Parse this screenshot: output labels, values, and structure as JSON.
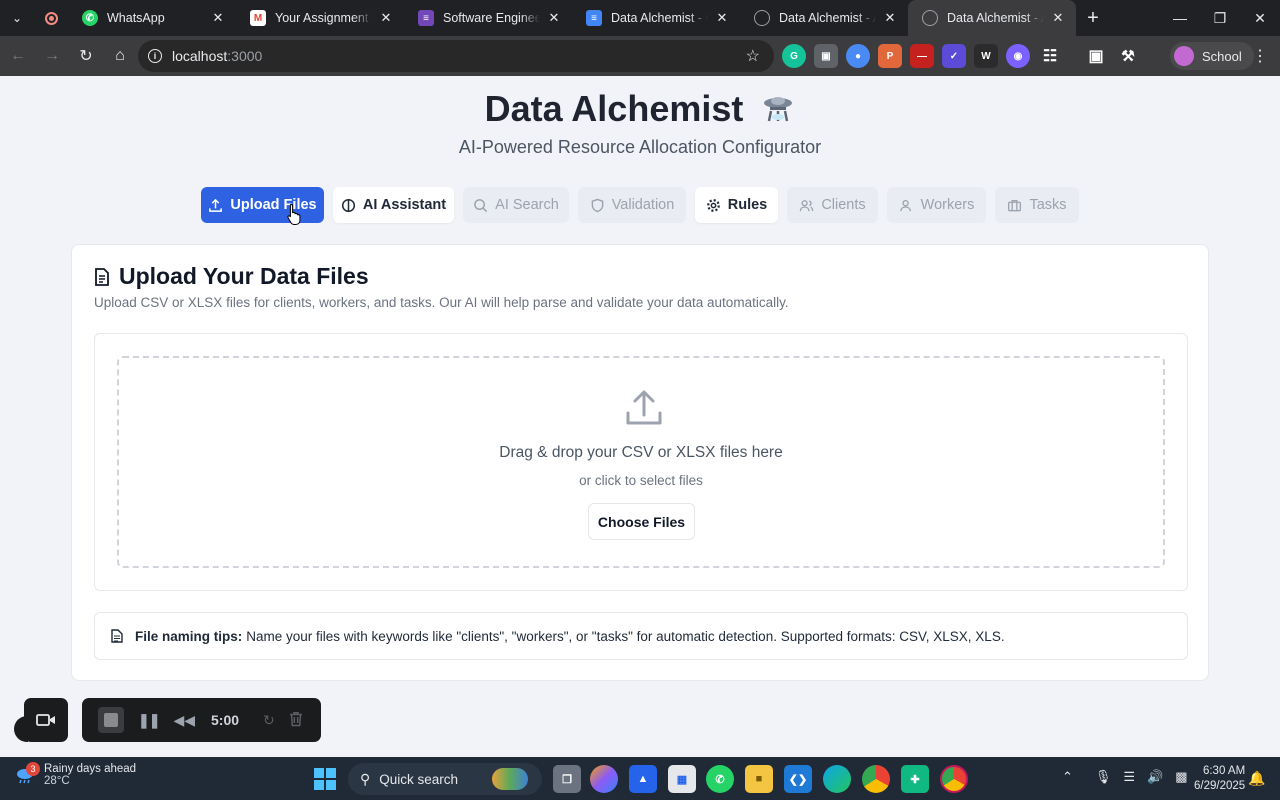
{
  "browser": {
    "tabs": [
      {
        "title": "WhatsApp",
        "favicon": "whatsapp-icon",
        "color": "#25d366"
      },
      {
        "title": "Your Assignment for th",
        "favicon": "gmail-icon",
        "color": "#ea4335"
      },
      {
        "title": "Software Engineering",
        "favicon": "forms-icon",
        "color": "#7248b9"
      },
      {
        "title": "Data Alchemist - Goo",
        "favicon": "docs-icon",
        "color": "#4285f4"
      },
      {
        "title": "Data Alchemist - AI Re",
        "favicon": "globe-icon",
        "color": "#9aa0a6"
      },
      {
        "title": "Data Alchemist - AI Re",
        "favicon": "globe-icon",
        "color": "#9aa0a6"
      }
    ],
    "url_host": "localhost",
    "url_port": ":3000",
    "profile_label": "School"
  },
  "app": {
    "title": "Data Alchemist",
    "subtitle": "AI-Powered Resource Allocation Configurator",
    "accent_color": "#2f62e3",
    "nav": [
      {
        "label": "Upload Files",
        "icon": "upload-icon",
        "state": "active"
      },
      {
        "label": "AI Assistant",
        "icon": "bulb-icon",
        "state": "enabled"
      },
      {
        "label": "AI Search",
        "icon": "search-icon",
        "state": "disabled"
      },
      {
        "label": "Validation",
        "icon": "shield-icon",
        "state": "disabled"
      },
      {
        "label": "Rules",
        "icon": "gear-icon",
        "state": "enabled"
      },
      {
        "label": "Clients",
        "icon": "users-icon",
        "state": "disabled"
      },
      {
        "label": "Workers",
        "icon": "user-icon",
        "state": "disabled"
      },
      {
        "label": "Tasks",
        "icon": "briefcase-icon",
        "state": "disabled"
      }
    ]
  },
  "upload": {
    "heading": "Upload Your Data Files",
    "description": "Upload CSV or XLSX files for clients, workers, and tasks. Our AI will help parse and validate your data automatically.",
    "drop_main": "Drag & drop your CSV or XLSX files here",
    "drop_sub": "or click to select files",
    "choose_label": "Choose Files",
    "tips_label": "File naming tips:",
    "tips_text": "Name your files with keywords like \"clients\", \"workers\", or \"tasks\" for automatic detection. Supported formats: CSV, XLSX, XLS."
  },
  "recorder": {
    "timer": "5:00"
  },
  "taskbar": {
    "weather_badge": "3",
    "weather_title": "Rainy days ahead",
    "weather_temp": "28°C",
    "search_label": "Quick search",
    "time": "6:30 AM",
    "date": "6/29/2025"
  }
}
